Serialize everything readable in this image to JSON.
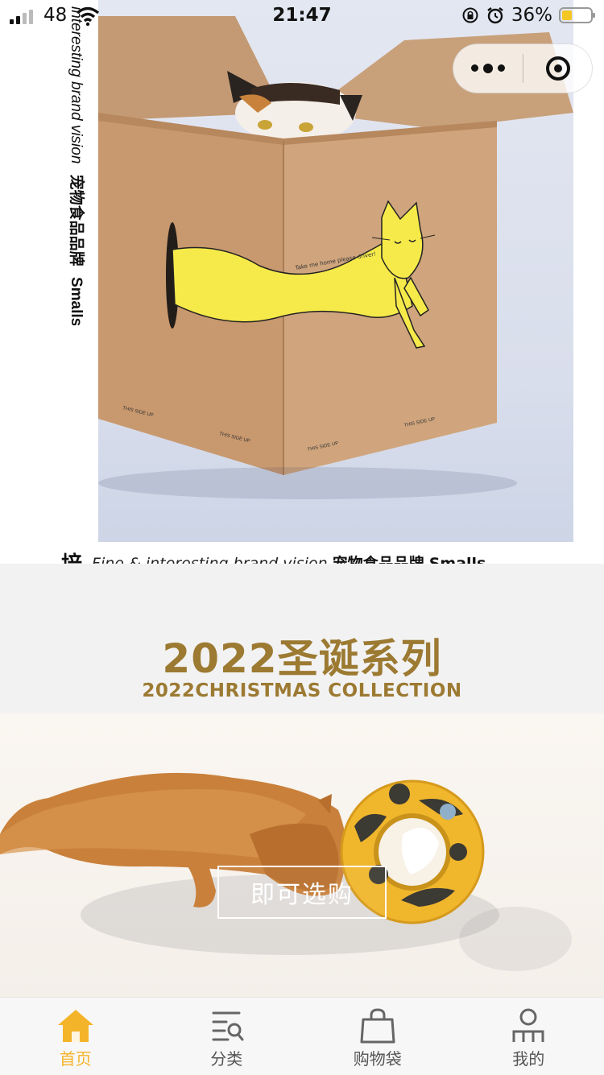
{
  "status_bar": {
    "network": "48",
    "time": "21:47",
    "battery": "36%"
  },
  "hero": {
    "vertical_caption_italic": "interesting brand vision",
    "vertical_caption_cn": "宠物食品品牌",
    "vertical_caption_brand": "Smalls",
    "box_print_text": "Take me home please driver!",
    "box_bottom_text": "THIS SIDE UP",
    "caption_lead": "培",
    "caption_italic": "Fine & interesting brand vision",
    "caption_cn": "宠物食品品牌",
    "caption_brand": "Smalls"
  },
  "collection": {
    "title": "2022圣诞系列",
    "subtitle": "2022CHRISTMAS COLLECTION",
    "shop_button": "即可选购"
  },
  "tabbar": {
    "items": [
      {
        "label": "首页",
        "icon": "home-icon",
        "active": true
      },
      {
        "label": "分类",
        "icon": "category-icon",
        "active": false
      },
      {
        "label": "购物袋",
        "icon": "shopping-bag-icon",
        "active": false
      },
      {
        "label": "我的",
        "icon": "profile-icon",
        "active": false
      }
    ]
  },
  "colors": {
    "accent": "#f4b42a",
    "collection_gold": "#9c7a32",
    "box_kraft": "#c79a71",
    "cat_yellow": "#f6ea4a"
  }
}
